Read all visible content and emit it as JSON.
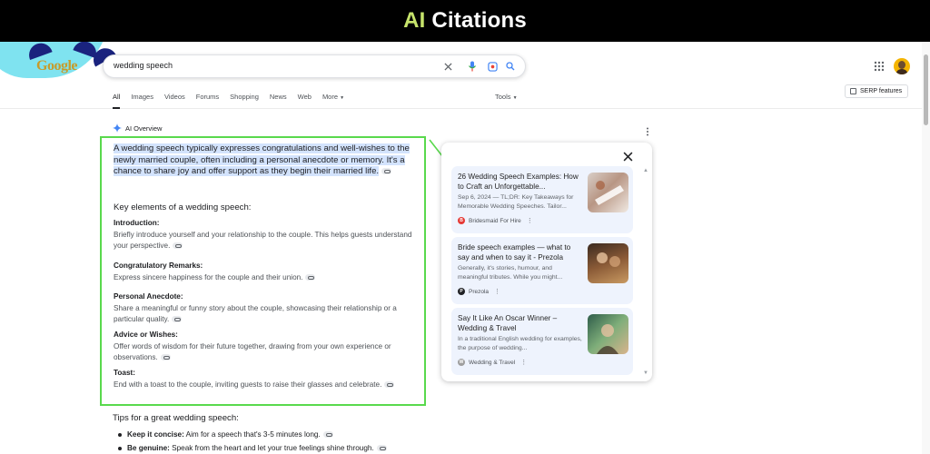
{
  "banner": {
    "accent": "AI",
    "rest": " Citations"
  },
  "header": {
    "logo_text": "Google",
    "search_value": "wedding speech",
    "tabs": [
      "All",
      "Images",
      "Videos",
      "Forums",
      "Shopping",
      "News",
      "Web",
      "More"
    ],
    "tools_label": "Tools",
    "serp_label": "SERP features"
  },
  "ai_overview": {
    "label": "AI Overview",
    "intro_highlight": "A wedding speech",
    "intro_rest": " typically expresses congratulations and well-wishes to the newly married couple, often including a personal anecdote or memory.",
    "intro_plain": " It's a chance to share joy and offer support as they begin their married life.",
    "key_title": "Key elements of a wedding speech:",
    "elements": [
      {
        "head": "Introduction:",
        "body": "Briefly introduce yourself and your relationship to the couple. This helps guests understand your perspective."
      },
      {
        "head": "Congratulatory Remarks:",
        "body": "Express sincere happiness for the couple and their union."
      },
      {
        "head": "Personal Anecdote:",
        "body": "Share a meaningful or funny story about the couple, showcasing their relationship or a particular quality."
      },
      {
        "head": "Advice or Wishes:",
        "body": "Offer words of wisdom for their future together, drawing from your own experience or observations."
      },
      {
        "head": "Toast:",
        "body": "End with a toast to the couple, inviting guests to raise their glasses and celebrate."
      }
    ],
    "tips_title": "Tips for a great wedding speech:",
    "tips": [
      {
        "head": "Keep it concise:",
        "body": " Aim for a speech that's 3-5 minutes long."
      },
      {
        "head": "Be genuine:",
        "body": " Speak from the heart and let your true feelings shine through."
      }
    ]
  },
  "citations": [
    {
      "title": "26 Wedding Speech Examples: How to Craft an Unforgettable...",
      "snippet": "Sep 6, 2024 — TL;DR: Key Takeaways for Memorable Wedding Speeches. Tailor...",
      "source": "Bridesmaid For Hire",
      "fav_color": "#e53935"
    },
    {
      "title": "Bride speech examples — what to say and when to say it - Prezola",
      "snippet": "Generally, it's stories, humour, and meaningful tributes. While you might...",
      "source": "Prezola",
      "fav_color": "#202124"
    },
    {
      "title": "Say It Like An Oscar Winner – Wedding & Travel",
      "snippet": "In a traditional English wedding for examples, the purpose of wedding...",
      "source": "Wedding & Travel",
      "fav_color": "#9e9e9e"
    }
  ],
  "colors": {
    "highlight_box": "#59d94d",
    "accent": "#c6e36b",
    "card_bg": "#eef3fd"
  }
}
